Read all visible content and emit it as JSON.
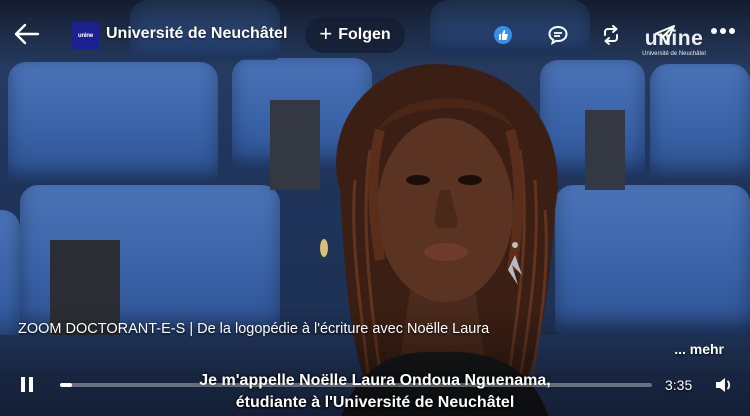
{
  "header": {
    "back_icon": "arrow-left-icon",
    "channel_logo_text": "unine",
    "channel_name": "Université de Neuchâtel",
    "follow_label": "Folgen",
    "follow_icon": "plus-icon",
    "actions": [
      {
        "name": "like-icon"
      },
      {
        "name": "comment-icon"
      },
      {
        "name": "repost-icon"
      },
      {
        "name": "send-icon"
      },
      {
        "name": "more-icon"
      }
    ]
  },
  "watermark": {
    "main": "unine",
    "sub": "Université de Neuchâtel"
  },
  "video": {
    "title": "ZOOM DOCTORANT-E-S | De la logopédie à l'écriture avec Noëlle Laura",
    "more_label": "... mehr",
    "subtitle_line1": "Je m'appelle Noëlle Laura Ondoua Nguenama,",
    "subtitle_line2": "étudiante à l'Université de Neuchâtel"
  },
  "player": {
    "state": "playing",
    "pause_icon": "pause-icon",
    "time_remaining": "3:35",
    "progress_fraction": 0.02,
    "volume_icon": "volume-icon"
  },
  "colors": {
    "seat_blue": "#3a63a8",
    "logo_blue": "#1b1f8f",
    "like_blue": "#378fe9"
  }
}
